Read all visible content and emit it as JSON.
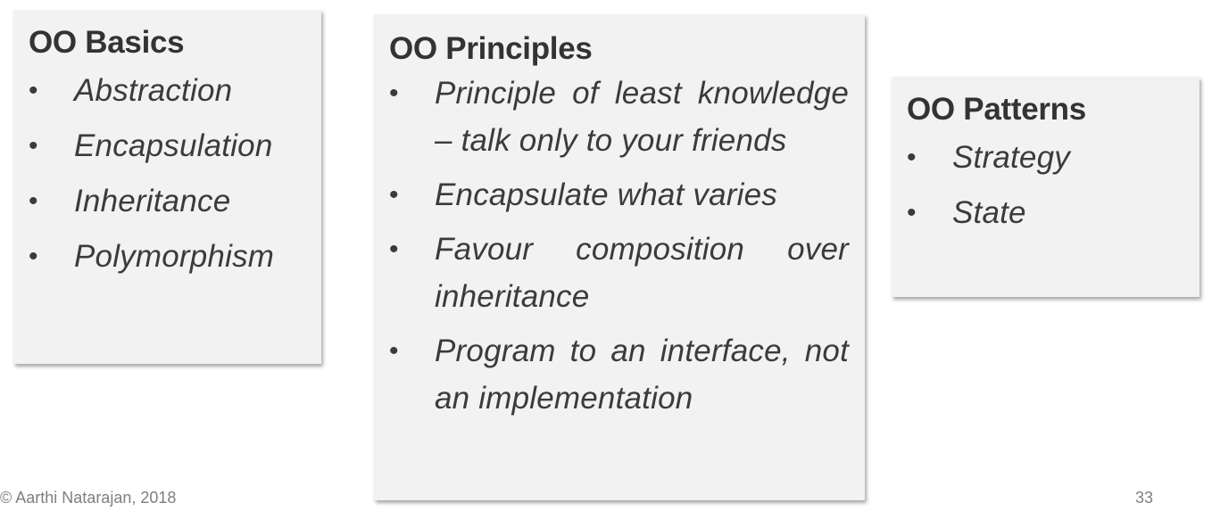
{
  "cards": {
    "basics": {
      "title": "OO Basics",
      "items": [
        "Abstraction",
        "Encapsulation",
        "Inheritance",
        "Polymorphism"
      ]
    },
    "principles": {
      "title": "OO Principles",
      "items": [
        "Principle of least knowledge – talk only to your friends",
        "Encapsulate what varies",
        "Favour composition over inheritance",
        "Program to an interface, not an implementation"
      ]
    },
    "patterns": {
      "title": "OO Patterns",
      "items": [
        "Strategy",
        "State"
      ]
    }
  },
  "bullet": "•",
  "footer": {
    "copyright": "© Aarthi Natarajan, 2018",
    "page_number": "33"
  }
}
